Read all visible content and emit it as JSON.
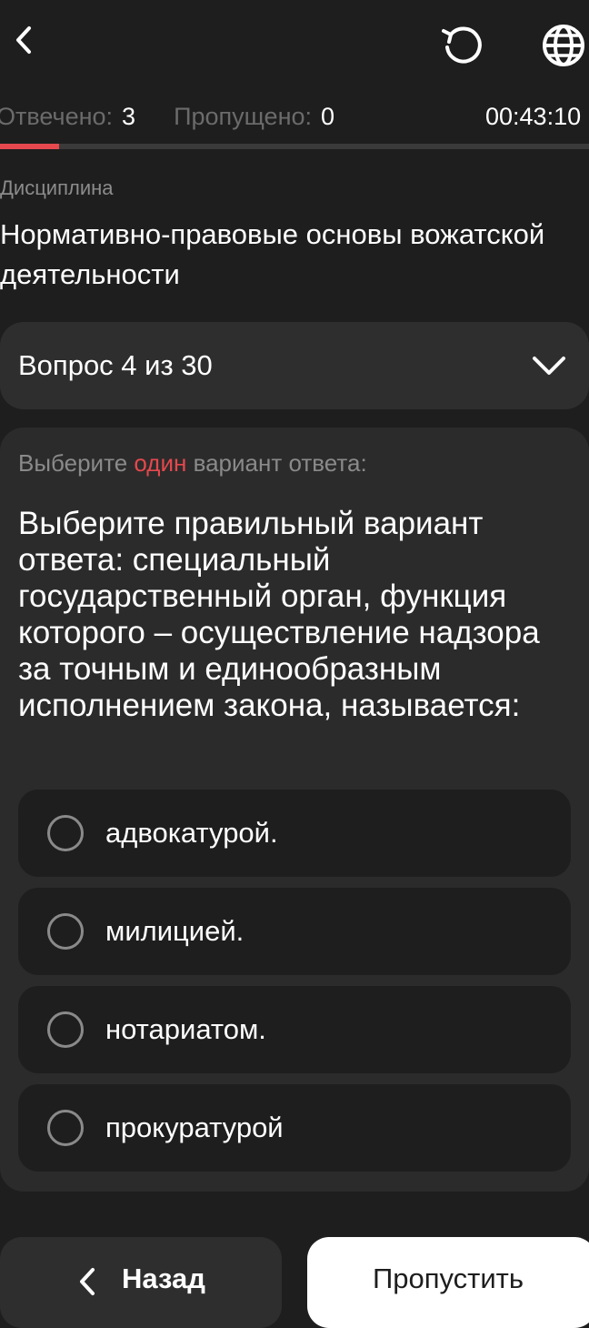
{
  "header": {
    "back_icon": "chevron-left-icon",
    "reload_icon": "reload-icon",
    "language_icon": "globe-icon"
  },
  "stats": {
    "answered_label": "Отвечено:",
    "answered_value": "3",
    "skipped_label": "Пропущено:",
    "skipped_value": "0",
    "timer": "00:43:10"
  },
  "progress": {
    "answered": 3,
    "total": 30
  },
  "discipline": {
    "label": "Дисциплина",
    "title": "Нормативно-правовые основы вожатской деятельности"
  },
  "question_selector": {
    "label": "Вопрос 4 из 30",
    "icon": "chevron-down-icon"
  },
  "question": {
    "hint_before": "Выберите",
    "hint_accent": "один",
    "hint_after": "вариант ответа:",
    "text": "Выберите правильный вариант ответа: специальный государственный орган, функция которого – осуществление надзора за точным и единообразным исполнением закона, называется:",
    "options": [
      {
        "label": "адвокатурой."
      },
      {
        "label": "милицией."
      },
      {
        "label": "нотариатом."
      },
      {
        "label": "прокуратурой"
      }
    ]
  },
  "footer": {
    "back_label": "Назад",
    "skip_label": "Пропустить"
  },
  "colors": {
    "background": "#1e1e1e",
    "card": "#2b2b2b",
    "accent": "#e5484d",
    "muted_text": "#8a8a8a"
  }
}
